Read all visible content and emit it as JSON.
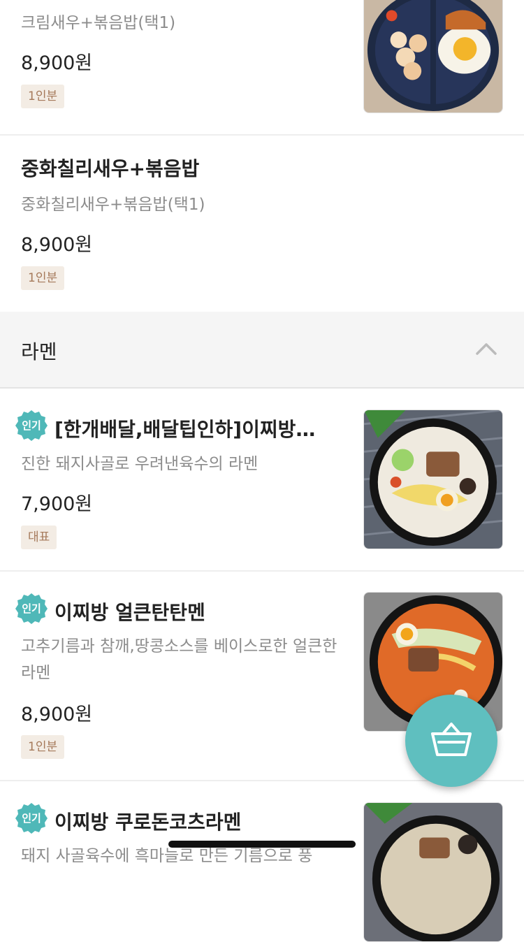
{
  "menu_items": [
    {
      "description": "크림새우+볶음밥(택1)",
      "price": "8,900원",
      "tag": "1인분",
      "image": "shrimp-friedrice-photo"
    },
    {
      "title": "중화칠리새우+볶음밥",
      "description": "중화칠리새우+볶음밥(택1)",
      "price": "8,900원",
      "tag": "1인분"
    }
  ],
  "category": {
    "title": "라멘",
    "toggle_icon": "chevron-up-icon"
  },
  "ramen_items": [
    {
      "badge": "인기",
      "title": "[한개배달,배달팁인하]이찌방…",
      "description": "진한 돼지사골로 우려낸육수의 라멘",
      "price": "7,900원",
      "tag": "대표",
      "image": "tonkotsu-ramen-photo"
    },
    {
      "badge": "인기",
      "title": "이찌방 얼큰탄탄멘",
      "description": "고추기름과 참깨,땅콩소스를 베이스로한 얼큰한 라멘",
      "price": "8,900원",
      "tag": "1인분",
      "image": "tantanmen-photo"
    },
    {
      "badge": "인기",
      "title": "이찌방 쿠로돈코츠라멘",
      "description": "돼지 사골육수에 흑마늘로 만든 기름으로 풍",
      "image": "kuro-tonkotsu-photo"
    }
  ],
  "colors": {
    "accent": "#5fbfbf",
    "badge": "#4fb8b8",
    "tag_bg": "#f3ece4",
    "tag_text": "#a5795a"
  },
  "cart_button": {
    "icon": "basket-icon"
  }
}
